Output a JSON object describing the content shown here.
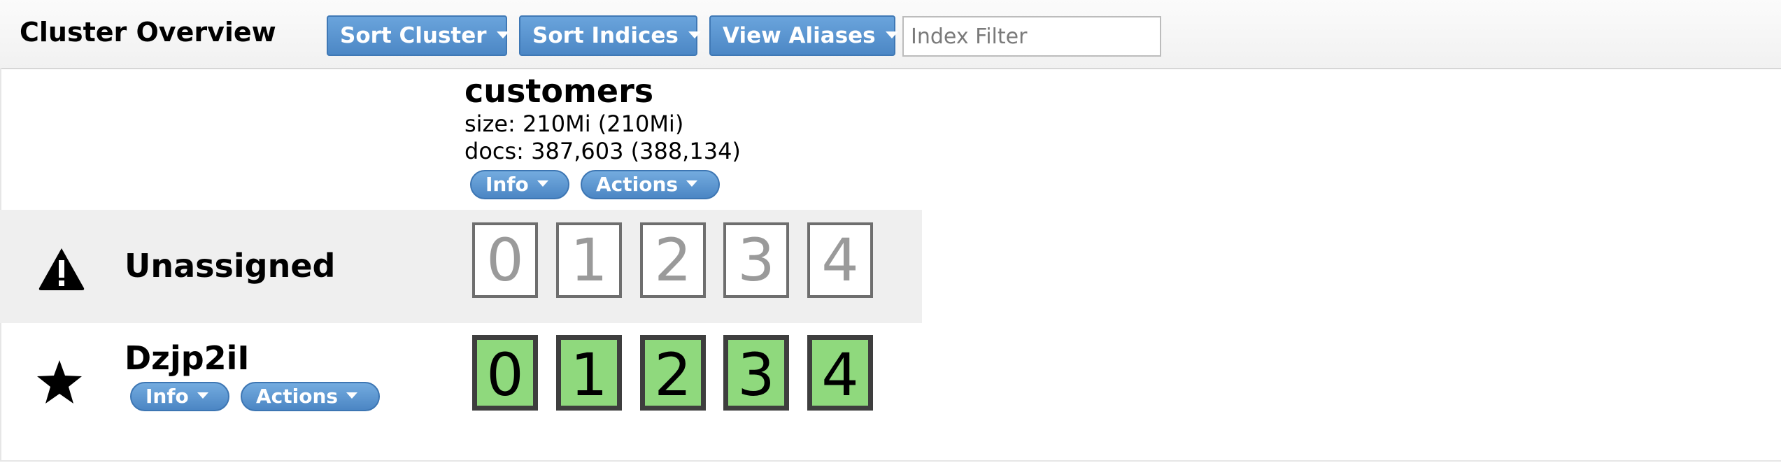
{
  "header": {
    "title": "Cluster Overview",
    "buttons": [
      {
        "label": "Sort Cluster"
      },
      {
        "label": "Sort Indices"
      },
      {
        "label": "View Aliases"
      }
    ],
    "filter_placeholder": "Index Filter"
  },
  "index": {
    "name": "customers",
    "size_line": "size: 210Mi (210Mi)",
    "docs_line": "docs: 387,603 (388,134)",
    "info_label": "Info",
    "actions_label": "Actions"
  },
  "rows": {
    "unassigned": {
      "label": "Unassigned",
      "icon": "warning-icon",
      "shards": [
        "0",
        "1",
        "2",
        "3",
        "4"
      ]
    },
    "node": {
      "label": "Dzjp2iI",
      "icon": "star-icon",
      "info_label": "Info",
      "actions_label": "Actions",
      "shards": [
        "0",
        "1",
        "2",
        "3",
        "4"
      ]
    }
  },
  "colors": {
    "button_blue": "#4c87c5",
    "shard_started": "#8fd97d",
    "unassigned_row_bg": "#efefef"
  }
}
